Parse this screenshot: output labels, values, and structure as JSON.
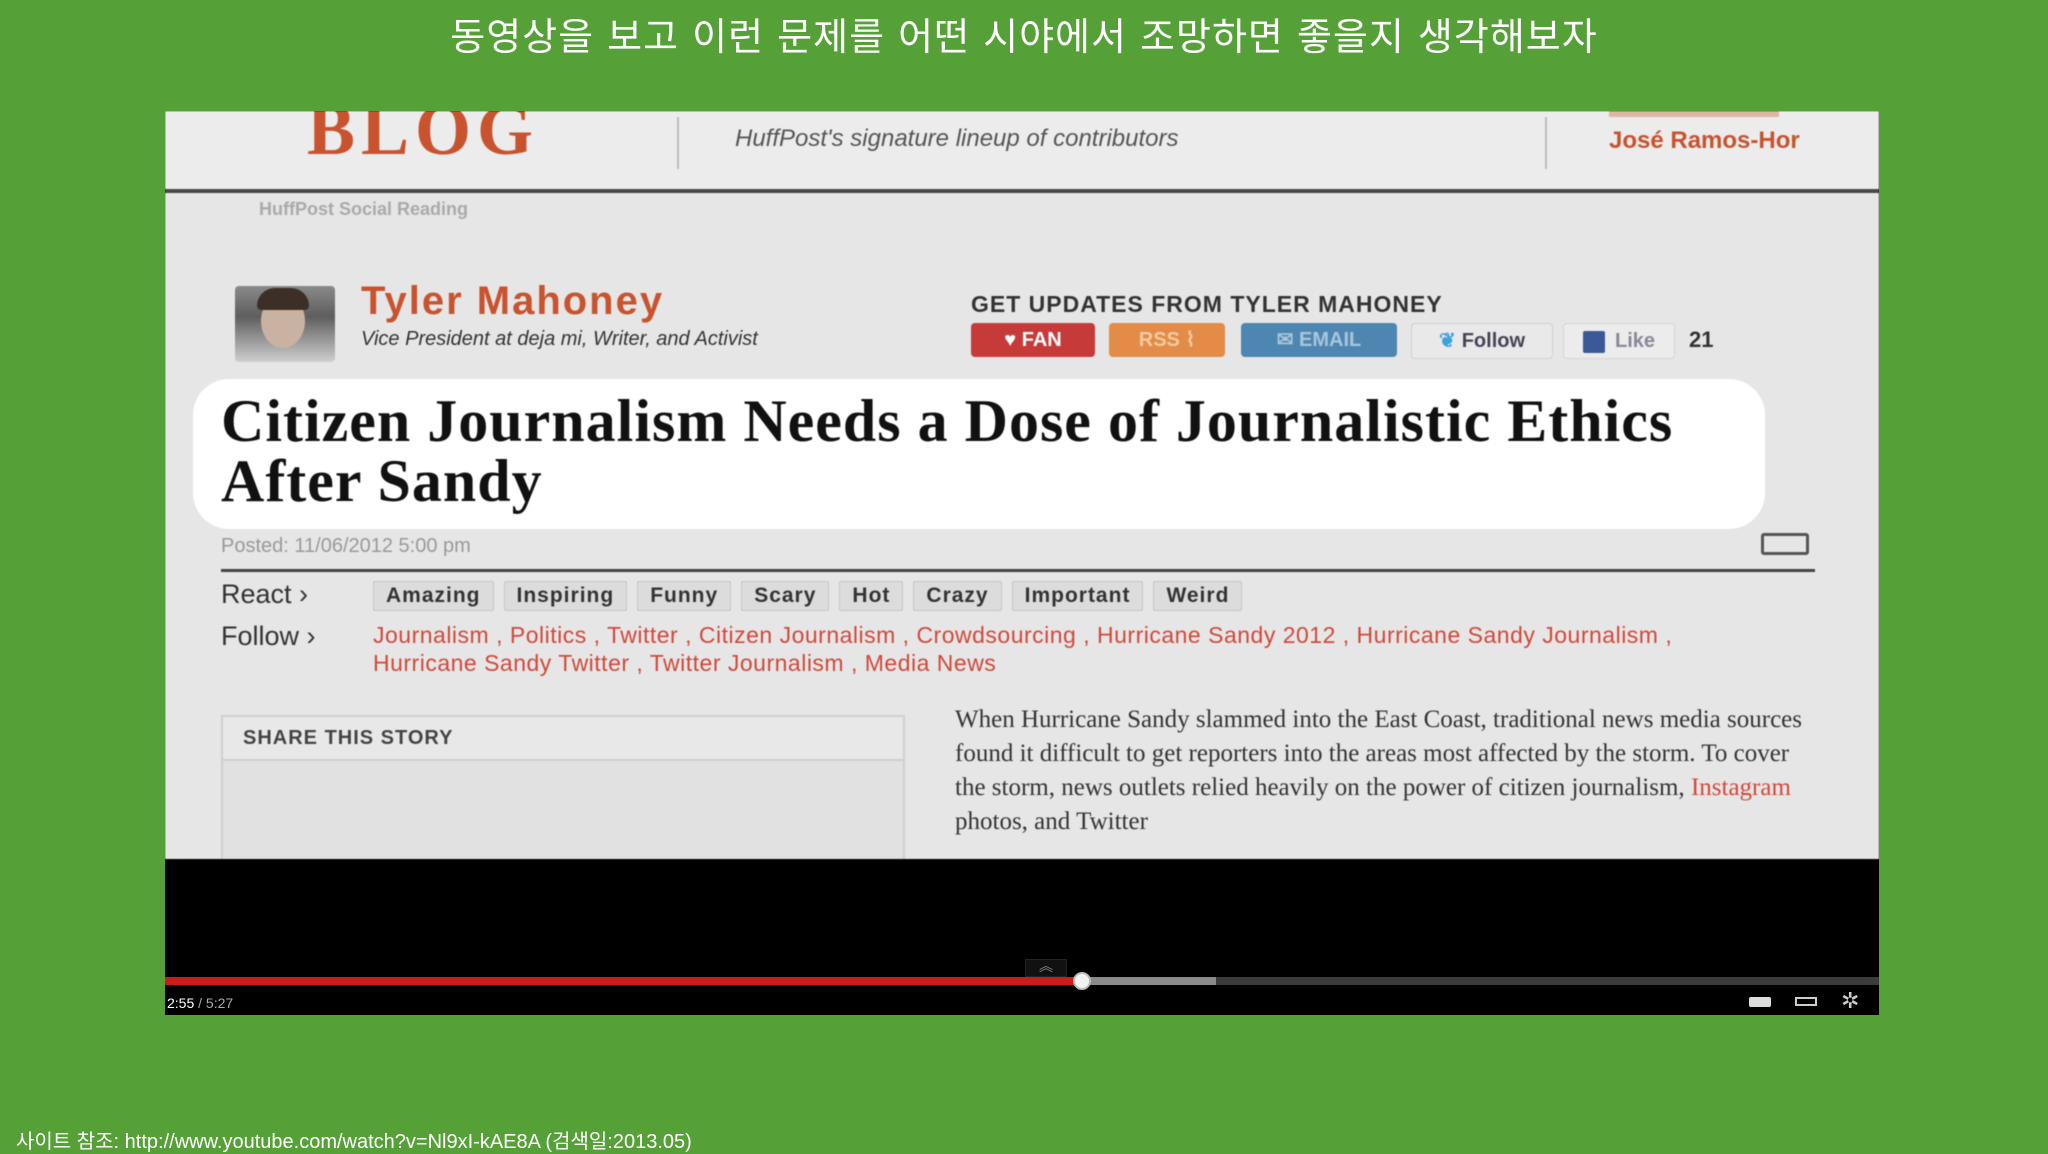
{
  "slide": {
    "title": "동영상을 보고 이런 문제를 어떤 시야에서 조망하면 좋을지 생각해보자",
    "source_line": "사이트 참조: http://www.youtube.com/watch?v=Nl9xI-kAE8A  (검색일:2013.05)"
  },
  "video_frame": {
    "header": {
      "blog_word": "BLOG",
      "subtitle": "HuffPost's signature lineup of contributors",
      "right_name": "José Ramos-Hor",
      "breadcrumb": "HuffPost Social Reading"
    },
    "author": {
      "name": "Tyler Mahoney",
      "role": "Vice President at deja mi, Writer, and Activist"
    },
    "updates": {
      "title": "GET UPDATES FROM TYLER MAHONEY",
      "buttons": [
        "FAN",
        "RSS",
        "EMAIL",
        "Follow",
        "Like"
      ],
      "like_count": "21"
    },
    "headline": "Citizen Journalism Needs a Dose of Journalistic Ethics After Sandy",
    "posted": "Posted: 11/06/2012 5:00 pm",
    "react": {
      "label": "React ›",
      "chips": [
        "Amazing",
        "Inspiring",
        "Funny",
        "Scary",
        "Hot",
        "Crazy",
        "Important",
        "Weird"
      ]
    },
    "follow": {
      "label": "Follow ›",
      "tags": "Journalism , Politics , Twitter , Citizen Journalism , Crowdsourcing , Hurricane Sandy 2012 , Hurricane Sandy Journalism , Hurricane Sandy Twitter , Twitter Journalism , Media News"
    },
    "share_title": "SHARE THIS STORY",
    "article": {
      "text": "When Hurricane Sandy slammed into the East Coast, traditional news media sources found it difficult to get reporters into the areas most affected by the storm. To cover the storm, news outlets relied heavily on the power of citizen journalism, ",
      "link": "Instagram",
      "tail": " photos, and Twitter"
    }
  },
  "player": {
    "current_time": "2:55",
    "separator": "/",
    "duration": "5:27",
    "progress_fraction": 0.535,
    "buffered_fraction": 0.613,
    "icons": [
      "captions-icon",
      "player-size-icon",
      "settings-gear-icon"
    ]
  },
  "colors": {
    "background": "#56a038",
    "progress": "#cc1b1b",
    "accent": "#c8532e"
  }
}
